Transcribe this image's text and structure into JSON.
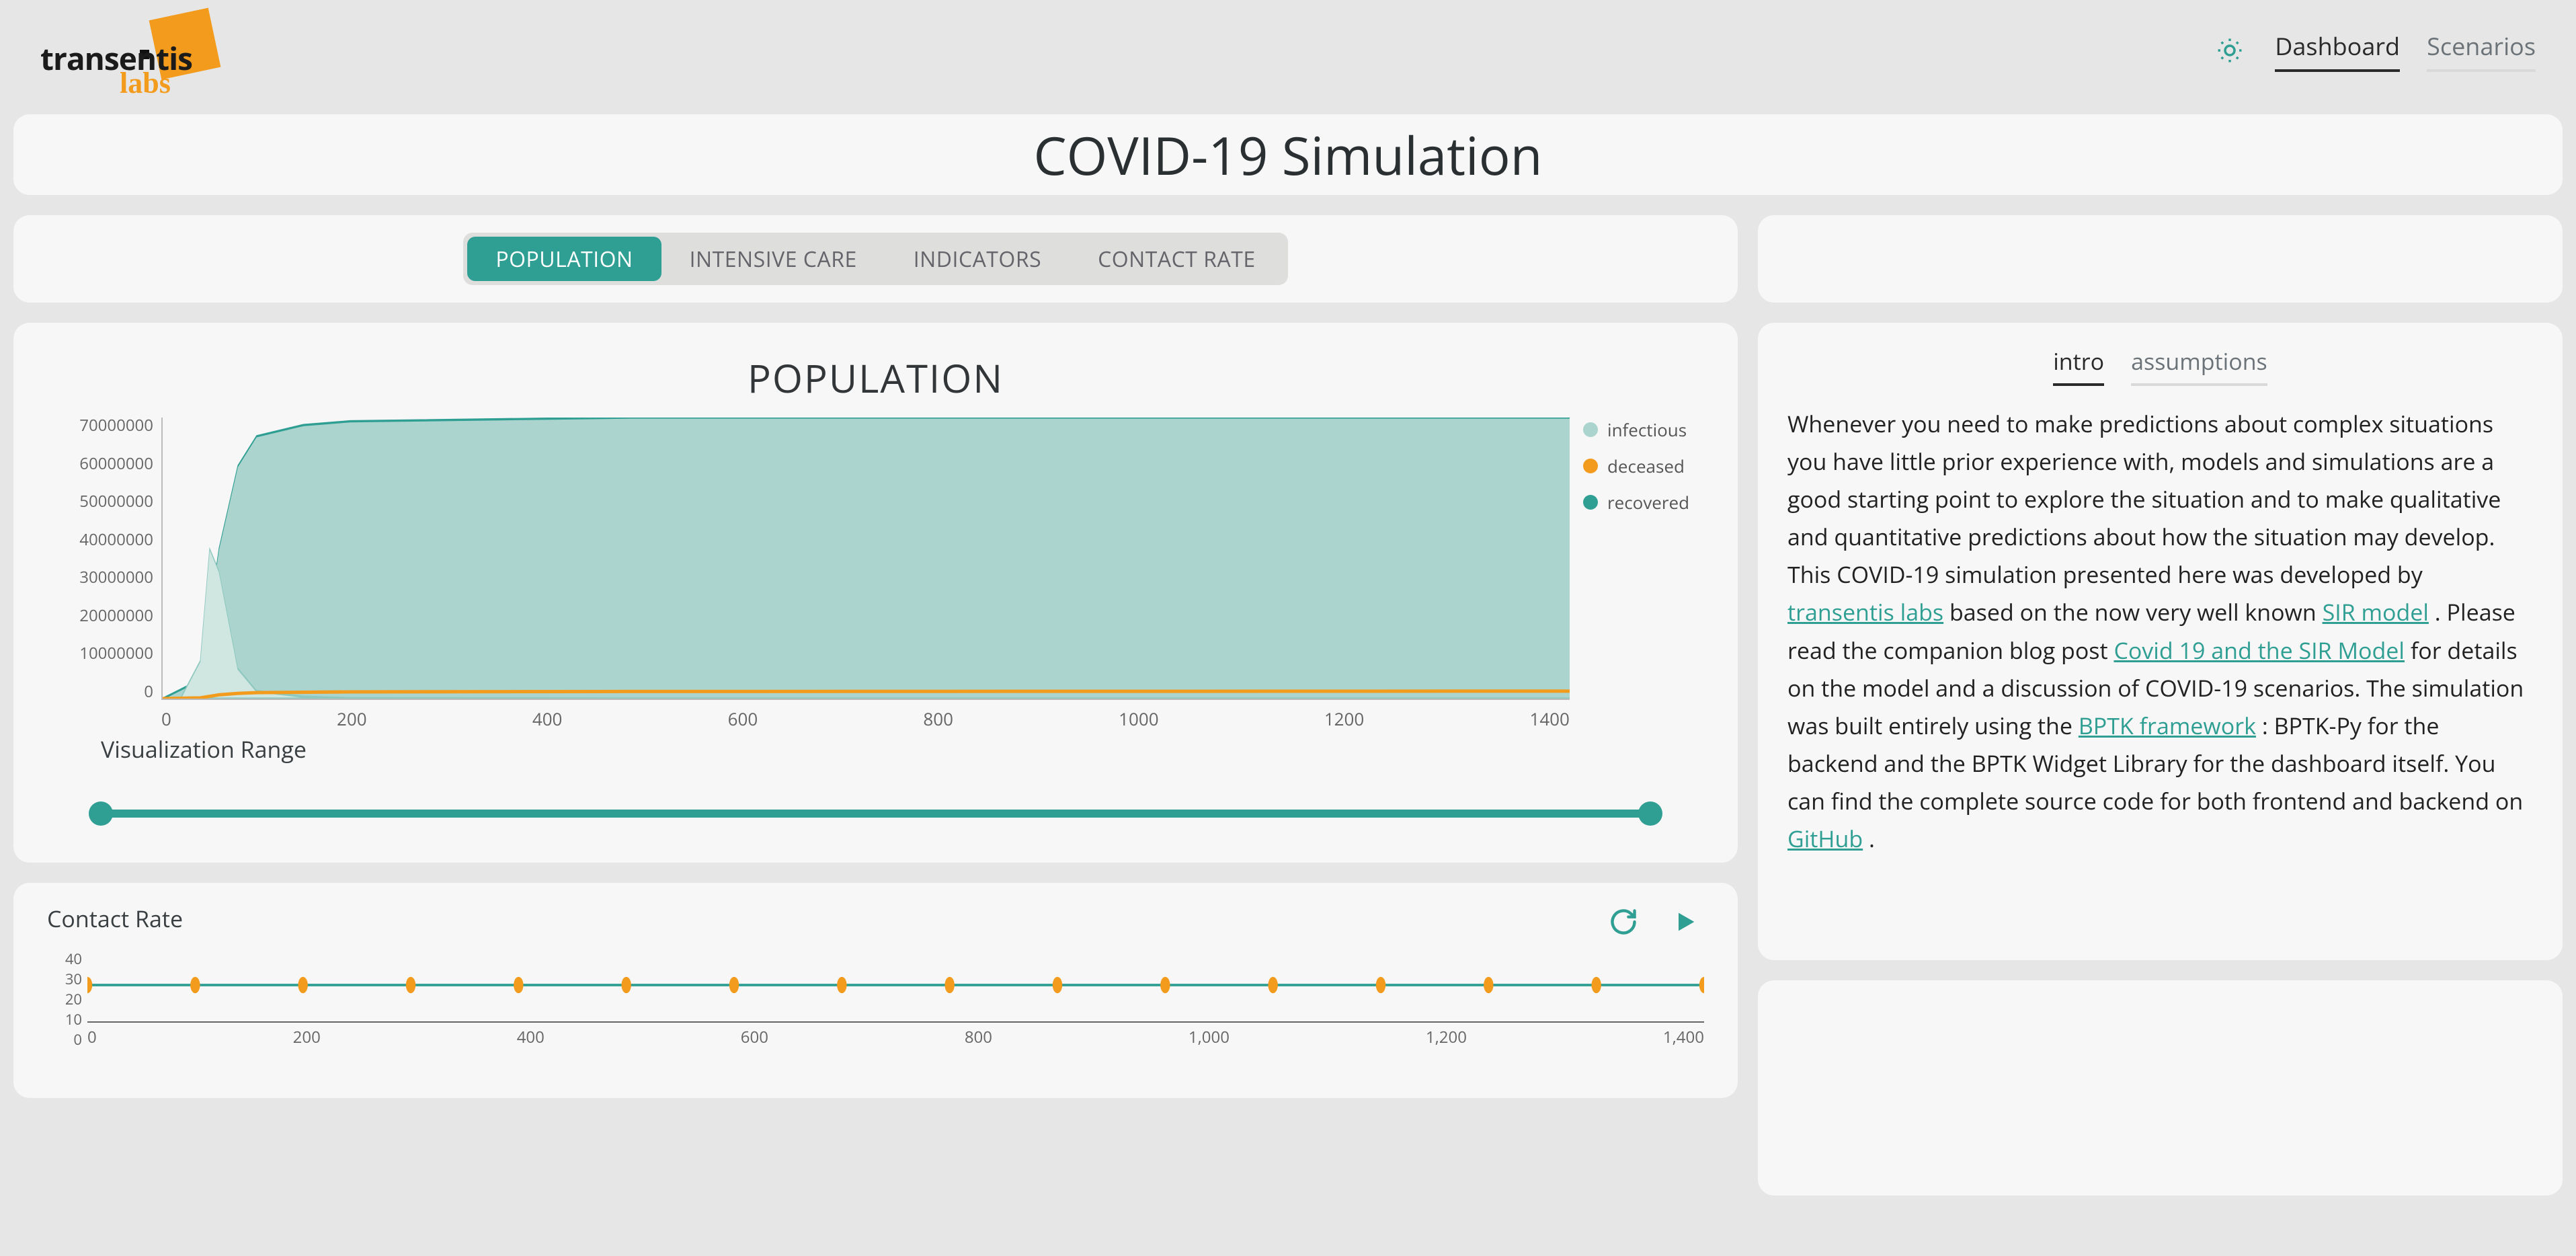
{
  "brand": {
    "word1": "transentis",
    "word2": "labs"
  },
  "nav": {
    "tabs": [
      "Dashboard",
      "Scenarios"
    ],
    "active": 0
  },
  "title": "COVID-19 Simulation",
  "segments": {
    "items": [
      "POPULATION",
      "INTENSIVE CARE",
      "INDICATORS",
      "CONTACT RATE"
    ],
    "active": 0
  },
  "viz_range_label": "Visualization Range",
  "chart_data": [
    {
      "id": "population",
      "type": "area",
      "title": "POPULATION",
      "x": {
        "label": "",
        "min": 0,
        "max": 1500,
        "ticks": [
          0,
          200,
          400,
          600,
          800,
          1000,
          1200,
          1400
        ]
      },
      "y": {
        "label": "",
        "min": 0,
        "max": 75000000,
        "ticks": [
          0,
          10000000,
          20000000,
          30000000,
          40000000,
          50000000,
          60000000,
          70000000
        ]
      },
      "series": [
        {
          "name": "infectious",
          "color": "#aad4cd",
          "points": [
            [
              20,
              500000
            ],
            [
              40,
              10000000
            ],
            [
              50,
              40000000
            ],
            [
              60,
              34000000
            ],
            [
              80,
              8000000
            ],
            [
              100,
              2000000
            ],
            [
              150,
              500000
            ],
            [
              200,
              100000
            ],
            [
              500,
              0
            ],
            [
              1500,
              0
            ]
          ]
        },
        {
          "name": "deceased",
          "color": "#f39b1d",
          "points": [
            [
              0,
              0
            ],
            [
              40,
              200000
            ],
            [
              60,
              1000000
            ],
            [
              80,
              1400000
            ],
            [
              100,
              1600000
            ],
            [
              200,
              1800000
            ],
            [
              500,
              1900000
            ],
            [
              1500,
              2000000
            ]
          ]
        },
        {
          "name": "recovered",
          "color": "#2f9e93",
          "points": [
            [
              0,
              0
            ],
            [
              40,
              5000000
            ],
            [
              60,
              40000000
            ],
            [
              80,
              62000000
            ],
            [
              100,
              70000000
            ],
            [
              150,
              73000000
            ],
            [
              200,
              74000000
            ],
            [
              500,
              75000000
            ],
            [
              1500,
              75000000
            ]
          ]
        }
      ],
      "legend_position": "right"
    },
    {
      "id": "contact_rate",
      "type": "line",
      "title": "Contact Rate",
      "x": {
        "label": "",
        "min": 0,
        "max": 1500,
        "ticks": [
          0,
          200,
          400,
          600,
          800,
          1000,
          1200,
          1400
        ],
        "tick_labels": [
          "0",
          "200",
          "400",
          "600",
          "800",
          "1,000",
          "1,200",
          "1,400"
        ]
      },
      "y": {
        "label": "",
        "min": 0,
        "max": 40,
        "ticks": [
          0,
          10,
          20,
          30,
          40
        ]
      },
      "series": [
        {
          "name": "contact_rate",
          "color": "#2f9e93",
          "marker": "#f39b1d",
          "points": [
            [
              0,
              20
            ],
            [
              100,
              20
            ],
            [
              200,
              20
            ],
            [
              300,
              20
            ],
            [
              400,
              20
            ],
            [
              500,
              20
            ],
            [
              600,
              20
            ],
            [
              700,
              20
            ],
            [
              800,
              20
            ],
            [
              900,
              20
            ],
            [
              1000,
              20
            ],
            [
              1100,
              20
            ],
            [
              1200,
              20
            ],
            [
              1300,
              20
            ],
            [
              1400,
              20
            ],
            [
              1500,
              20
            ]
          ]
        }
      ]
    }
  ],
  "viz_range": {
    "from": 0,
    "to": 1500,
    "min": 0,
    "max": 1500
  },
  "info": {
    "tabs": [
      "intro",
      "assumptions"
    ],
    "active": 0,
    "text_pre": "Whenever you need to make predictions about complex situations you have little prior experience with, models and simulations are a good starting point to explore the situation and to make qualitative and quantitative predictions about how the situation may develop. This COVID-19 simulation presented here was developed by ",
    "link1": "transentis labs",
    "text_mid1": " based on the now very well known ",
    "link2": "SIR model",
    "text_mid2": ". Please read the companion blog post ",
    "link3": "Covid 19 and the SIR Model",
    "text_mid3": " for details on the model and a discussion of COVID-19 scenarios. The simulation was built entirely using the ",
    "link4": "BPTK framework",
    "text_mid4": ": BPTK-Py for the backend and the BPTK Widget Library for the dashboard itself. You can find the complete source code for both frontend and backend on ",
    "link5": "GitHub",
    "text_end": "."
  }
}
